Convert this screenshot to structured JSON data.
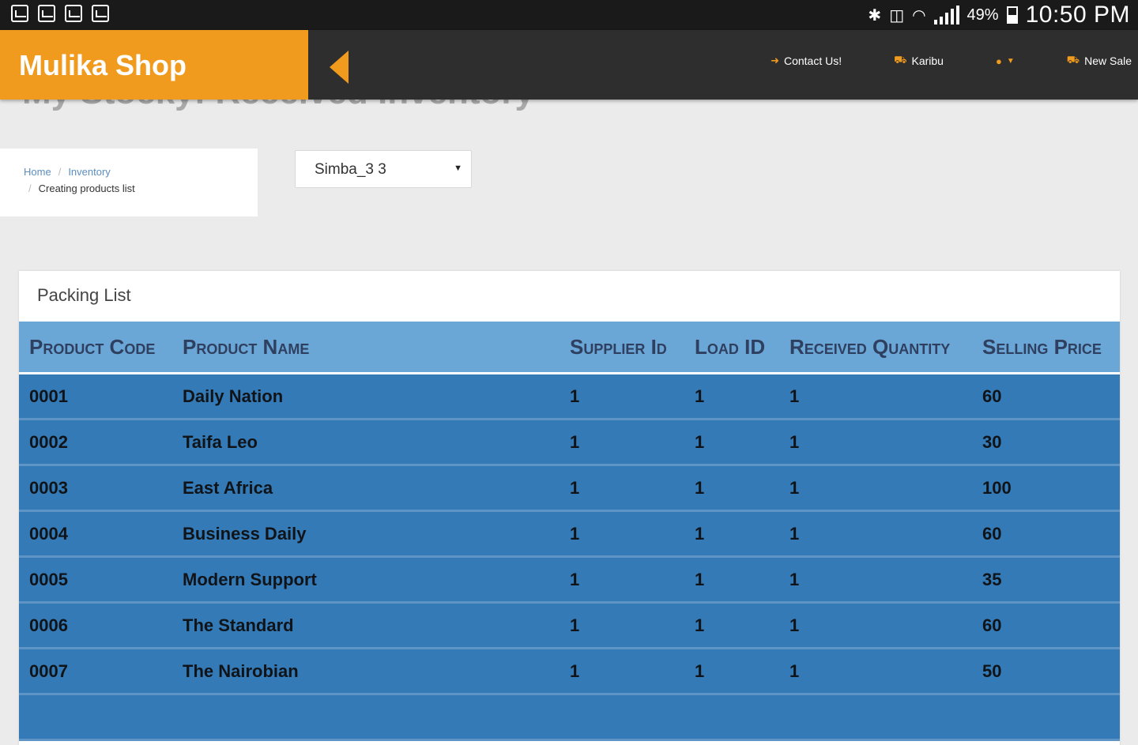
{
  "status_bar": {
    "battery": "49%",
    "time": "10:50 PM"
  },
  "app_bar": {
    "brand": "Mulika Shop",
    "nav": [
      {
        "label": "Contact Us!",
        "icon": "sign-in-icon"
      },
      {
        "label": "Karibu",
        "icon": "cart-icon"
      },
      {
        "label": "",
        "icon": "user-icon"
      },
      {
        "label": "New Sale",
        "icon": "cart-icon"
      }
    ]
  },
  "page": {
    "heading_partial": "My Stocky: Received Inventory"
  },
  "breadcrumb": {
    "home": "Home",
    "section": "Inventory",
    "current": "Creating products list"
  },
  "select": {
    "value": "Simba_3 3"
  },
  "packing_list": {
    "title": "Packing List",
    "columns": [
      "Product Code",
      "Product Name",
      "Supplier Id",
      "Load ID",
      "Received Quantity",
      "Selling Price"
    ],
    "rows": [
      [
        "0001",
        "Daily Nation",
        "1",
        "1",
        "1",
        "60"
      ],
      [
        "0002",
        "Taifa Leo",
        "1",
        "1",
        "1",
        "30"
      ],
      [
        "0003",
        "East Africa",
        "1",
        "1",
        "1",
        "100"
      ],
      [
        "0004",
        "Business Daily",
        "1",
        "1",
        "1",
        "60"
      ],
      [
        "0005",
        "Modern Support",
        "1",
        "1",
        "1",
        "35"
      ],
      [
        "0006",
        "The Standard",
        "1",
        "1",
        "1",
        "60"
      ],
      [
        "0007",
        "The Nairobian",
        "1",
        "1",
        "1",
        "50"
      ],
      [
        "",
        "",
        "",
        "",
        "",
        ""
      ]
    ]
  },
  "colors": {
    "brand_orange": "#f09a1e",
    "appbar_dark": "#2e2e2e",
    "table_header": "#6aa6d6",
    "table_row": "#337ab7"
  }
}
